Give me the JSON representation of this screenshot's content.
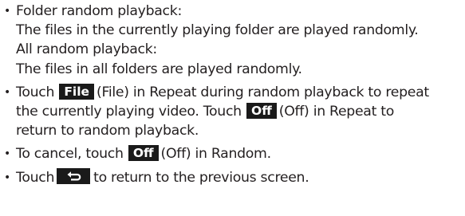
{
  "colors": {
    "text": "#231f20",
    "key_background": "#1a1a1a",
    "key_text": "#ffffff"
  },
  "bullet_1": {
    "folder_title": "Folder random playback:",
    "folder_desc": "The files in the currently playing folder are played randomly.",
    "all_title": "All random playback:",
    "all_desc": "The files in all folders are played randomly."
  },
  "bullet_2": {
    "text_1": "Touch",
    "key_file": "File",
    "text_2": "(File) in Repeat during random playback to repeat",
    "text_3": "the currently playing video. Touch",
    "key_off": "Off",
    "text_4": "(Off) in Repeat to",
    "text_5": "return to random playback."
  },
  "bullet_3": {
    "text_1": "To cancel, touch",
    "key_off": "Off",
    "text_2": "(Off) in Random."
  },
  "bullet_4": {
    "text_1": "Touch",
    "key_icon": "return-arrow-icon",
    "text_2": "to return to the previous screen."
  }
}
